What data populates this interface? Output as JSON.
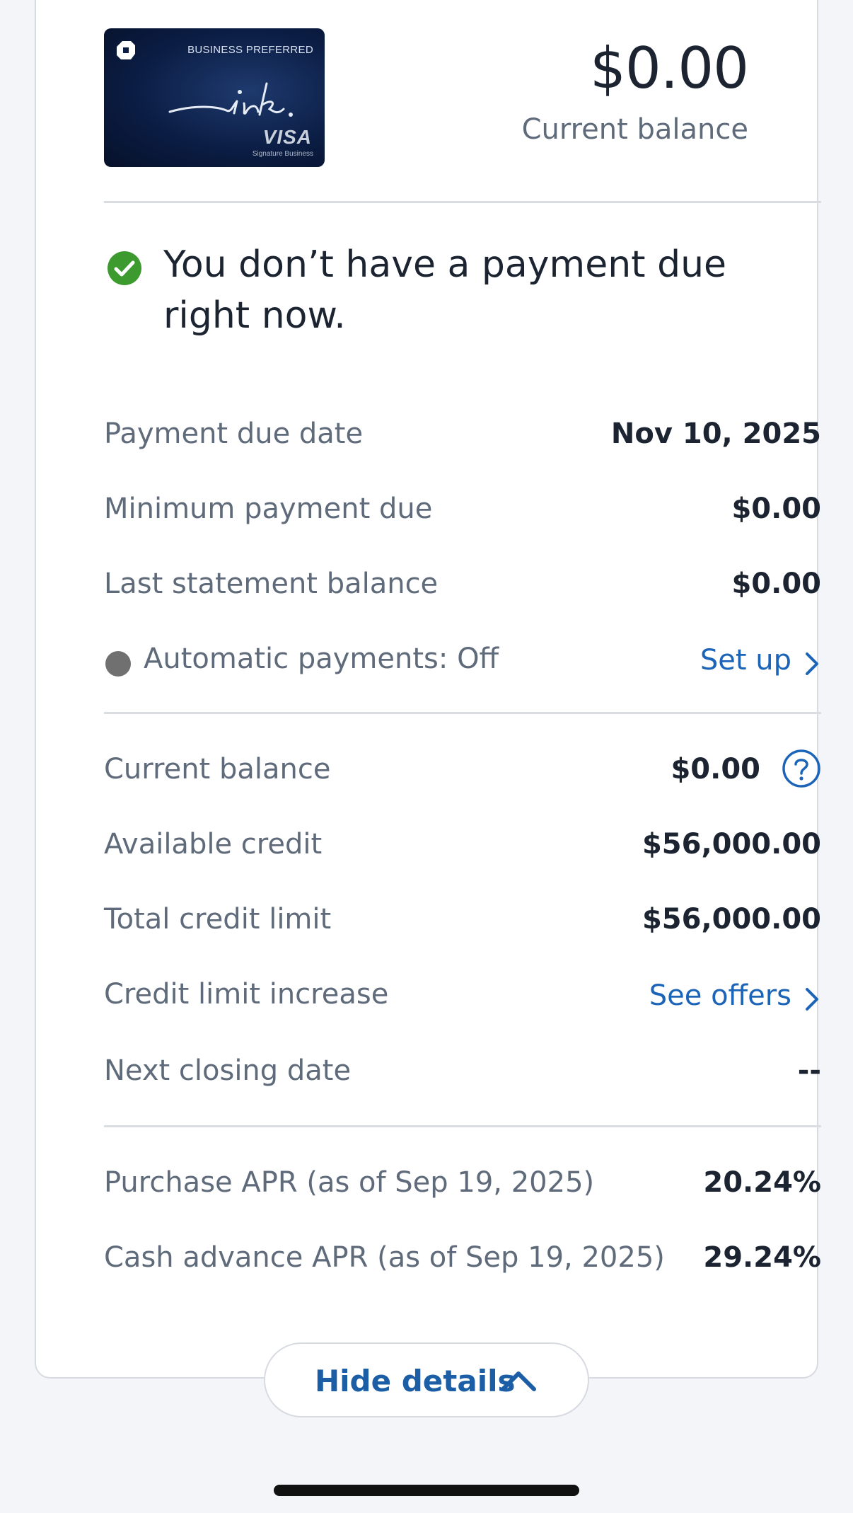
{
  "card": {
    "tier_label": "BUSINESS PREFERRED",
    "brand_script": "ink.",
    "network": "VISA",
    "network_sub": "Signature Business"
  },
  "hero": {
    "amount": "$0.00",
    "label": "Current balance"
  },
  "status": {
    "message": "You don’t have a payment due right now."
  },
  "payment": {
    "due_date_label": "Payment due date",
    "due_date_value": "Nov 10, 2025",
    "min_due_label": "Minimum payment due",
    "min_due_value": "$0.00",
    "last_statement_label": "Last statement balance",
    "last_statement_value": "$0.00",
    "autopay_label": "Automatic payments: Off",
    "autopay_link": "Set up"
  },
  "credit": {
    "current_balance_label": "Current balance",
    "current_balance_value": "$0.00",
    "available_label": "Available credit",
    "available_value": "$56,000.00",
    "limit_label": "Total credit limit",
    "limit_value": "$56,000.00",
    "increase_label": "Credit limit increase",
    "increase_link": "See offers",
    "closing_label": "Next closing date",
    "closing_value": "--"
  },
  "apr": {
    "purchase_label": "Purchase APR (as of Sep 19, 2025)",
    "purchase_value": "20.24%",
    "cash_label": "Cash advance APR (as of Sep 19, 2025)",
    "cash_value": "29.24%"
  },
  "actions": {
    "hide_details": "Hide details"
  },
  "colors": {
    "link": "#1c64b8",
    "success": "#3d9a2f",
    "text": "#1b2430",
    "muted": "#5f6b7a"
  }
}
